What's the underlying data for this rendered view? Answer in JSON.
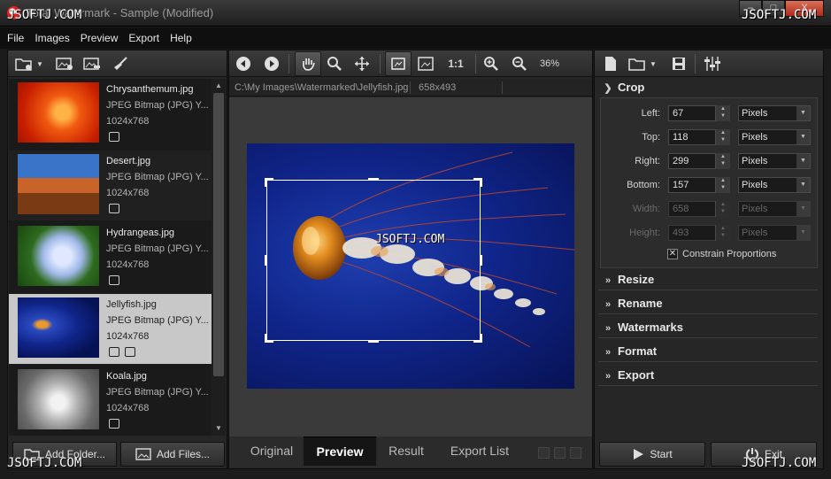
{
  "window": {
    "title": "Total Watermark - Sample (Modified)",
    "minimize": "–",
    "maximize": "□",
    "close": "X"
  },
  "watermark_text": "JSOFTJ.COM",
  "menu": [
    "File",
    "Images",
    "Preview",
    "Export",
    "Help"
  ],
  "files": [
    {
      "name": "Chrysanthemum.jpg",
      "type": "JPEG Bitmap (JPG) Y...",
      "dims": "1024x768"
    },
    {
      "name": "Desert.jpg",
      "type": "JPEG Bitmap (JPG) Y...",
      "dims": "1024x768"
    },
    {
      "name": "Hydrangeas.jpg",
      "type": "JPEG Bitmap (JPG) Y...",
      "dims": "1024x768"
    },
    {
      "name": "Jellyfish.jpg",
      "type": "JPEG Bitmap (JPG) Y...",
      "dims": "1024x768"
    },
    {
      "name": "Koala.jpg",
      "type": "JPEG Bitmap (JPG) Y...",
      "dims": "1024x768"
    }
  ],
  "left_buttons": {
    "add_folder": "Add Folder...",
    "add_files": "Add Files..."
  },
  "preview": {
    "zoom": "36%",
    "one_to_one": "1:1",
    "path": "C:\\My Images\\Watermarked\\Jellyfish.jpg",
    "size": "658x493",
    "overlay_text": "JSOFTJ.COM"
  },
  "tabs": [
    "Original",
    "Preview",
    "Result",
    "Export List"
  ],
  "active_tab": "Preview",
  "crop": {
    "title": "Crop",
    "fields": [
      {
        "label": "Left:",
        "value": "67",
        "unit": "Pixels",
        "enabled": true
      },
      {
        "label": "Top:",
        "value": "118",
        "unit": "Pixels",
        "enabled": true
      },
      {
        "label": "Right:",
        "value": "299",
        "unit": "Pixels",
        "enabled": true
      },
      {
        "label": "Bottom:",
        "value": "157",
        "unit": "Pixels",
        "enabled": true
      },
      {
        "label": "Width:",
        "value": "658",
        "unit": "Pixels",
        "enabled": false
      },
      {
        "label": "Height:",
        "value": "493",
        "unit": "Pixels",
        "enabled": false
      }
    ],
    "constrain_label": "Constrain Proportions",
    "constrain_checked": true
  },
  "sections": [
    "Resize",
    "Rename",
    "Watermarks",
    "Format",
    "Export"
  ],
  "right_buttons": {
    "start": "Start",
    "exit": "Exit"
  },
  "colors": {
    "accent_selected": "#c8c8c8",
    "panel": "#262626",
    "photo_blue": "#10258a"
  }
}
